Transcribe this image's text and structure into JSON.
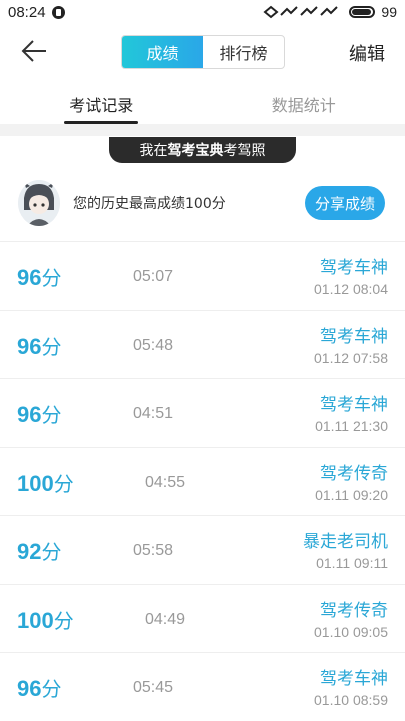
{
  "status_bar": {
    "time": "08:24",
    "battery": "99"
  },
  "header": {
    "segments": [
      {
        "label": "成绩",
        "active": true
      },
      {
        "label": "排行榜",
        "active": false
      }
    ],
    "edit_label": "编辑"
  },
  "tabs": [
    {
      "label": "考试记录",
      "active": true
    },
    {
      "label": "数据统计",
      "active": false
    }
  ],
  "banner": {
    "prefix": "我在",
    "brand": "驾考宝典",
    "suffix": "考驾照"
  },
  "best": {
    "text": "您的历史最高成绩100分",
    "share_label": "分享成绩"
  },
  "records": [
    {
      "score": "96",
      "unit": "分",
      "duration": "05:07",
      "rank": "驾考车神",
      "date": "01.12",
      "time": "08:04"
    },
    {
      "score": "96",
      "unit": "分",
      "duration": "05:48",
      "rank": "驾考车神",
      "date": "01.12",
      "time": "07:58"
    },
    {
      "score": "96",
      "unit": "分",
      "duration": "04:51",
      "rank": "驾考车神",
      "date": "01.11",
      "time": "21:30"
    },
    {
      "score": "100",
      "unit": "分",
      "duration": "04:55",
      "rank": "驾考传奇",
      "date": "01.11",
      "time": "09:20"
    },
    {
      "score": "92",
      "unit": "分",
      "duration": "05:58",
      "rank": "暴走老司机",
      "date": "01.11",
      "time": "09:11"
    },
    {
      "score": "100",
      "unit": "分",
      "duration": "04:49",
      "rank": "驾考传奇",
      "date": "01.10",
      "time": "09:05"
    },
    {
      "score": "96",
      "unit": "分",
      "duration": "05:45",
      "rank": "驾考车神",
      "date": "01.10",
      "time": "08:59"
    }
  ],
  "colors": {
    "accent": "#2aa7d6",
    "active_segment": "#22c7d9",
    "share_button": "#2aa7e8"
  }
}
